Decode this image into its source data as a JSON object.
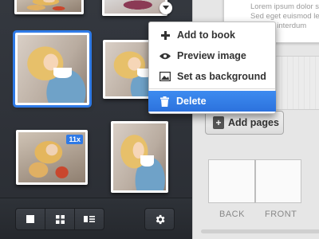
{
  "context_menu": {
    "items": [
      {
        "label": "Add to book",
        "icon": "plus-icon"
      },
      {
        "label": "Preview image",
        "icon": "eye-icon"
      },
      {
        "label": "Set as background",
        "icon": "image-icon"
      }
    ],
    "danger_item": {
      "label": "Delete",
      "icon": "trash-icon"
    }
  },
  "thumbnails": {
    "badge": "11x"
  },
  "right_panel": {
    "preview_lines": [
      "Lorem ipsum dolor s",
      "Sed eget euismod le",
      "facilisis interdum"
    ],
    "add_pages_label": "Add pages",
    "back_label": "BACK",
    "front_label": "FRONT"
  },
  "colors": {
    "accent": "#2f7ae6",
    "dark_panel": "#2b2f35",
    "light_panel": "#e6e6e6"
  }
}
